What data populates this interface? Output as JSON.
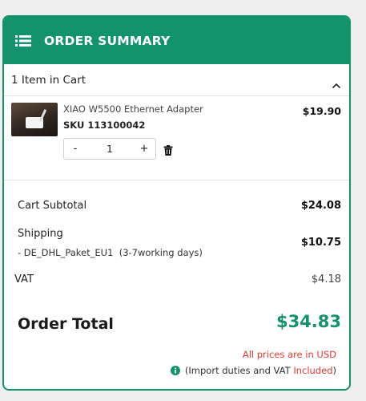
{
  "header": {
    "title": "ORDER SUMMARY",
    "icon": "list-icon"
  },
  "cart": {
    "count_label": "1 Item in Cart",
    "toggle_icon": "chevron-up-icon"
  },
  "item": {
    "name": "XIAO W5500 Ethernet Adapter",
    "sku": "SKU 113100042",
    "price": "$19.90",
    "quantity": "1",
    "minus_label": "-",
    "plus_label": "+",
    "delete_icon": "trash-icon"
  },
  "summary": {
    "subtotal_label": "Cart Subtotal",
    "subtotal_value": "$24.08",
    "shipping_label": "Shipping",
    "shipping_method": "- DE_DHL_Paket_EU1",
    "shipping_time": "(3-7working days)",
    "shipping_value": "$10.75",
    "vat_label": "VAT",
    "vat_value": "$4.18",
    "total_label": "Order Total",
    "total_value": "$34.83"
  },
  "notes": {
    "currency": "All prices are in USD",
    "duties_prefix": "(Import duties and VAT",
    "duties_highlight": "Included",
    "duties_suffix": ")"
  },
  "colors": {
    "accent": "#13936b",
    "alert": "#e53935"
  }
}
